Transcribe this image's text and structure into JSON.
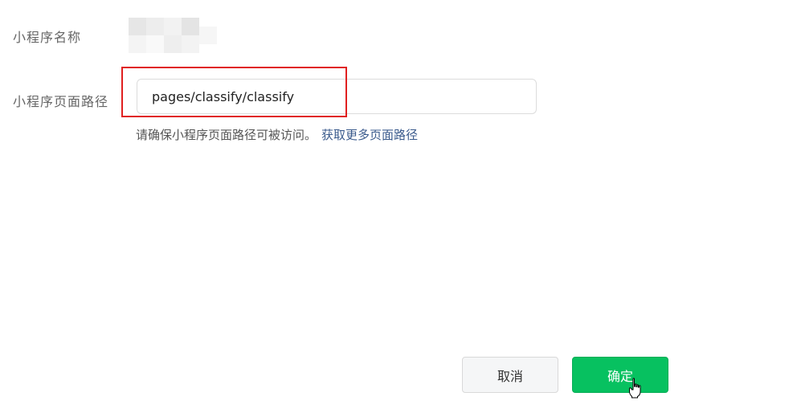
{
  "form": {
    "name_label": "小程序名称",
    "path_label": "小程序页面路径",
    "path_value": "pages/classify/classify",
    "hint_text": "请确保小程序页面路径可被访问。",
    "hint_link": "获取更多页面路径"
  },
  "buttons": {
    "cancel_label": "取消",
    "confirm_label": "确定"
  },
  "colors": {
    "confirm_bg": "#07c160",
    "highlight": "#e02020",
    "link": "#3a5a8c"
  },
  "icons": {
    "cursor": "hand-pointer-icon"
  }
}
